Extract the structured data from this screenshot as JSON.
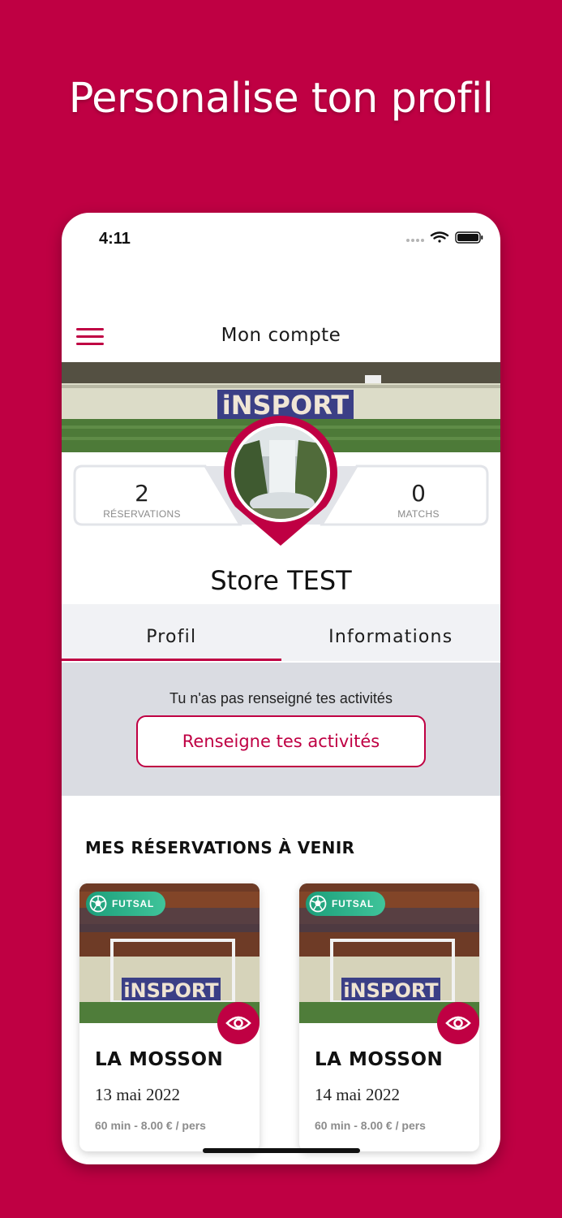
{
  "headline": "Personalise ton profil",
  "status_bar": {
    "time": "4:11"
  },
  "nav": {
    "title": "Mon compte"
  },
  "stats": {
    "reservations": {
      "value": "2",
      "label": "RÉSERVATIONS"
    },
    "matches": {
      "value": "0",
      "label": "MATCHS"
    }
  },
  "profile": {
    "name": "Store  TEST"
  },
  "tabs": [
    {
      "label": "Profil"
    },
    {
      "label": "Informations"
    }
  ],
  "activities": {
    "message": "Tu n'as pas renseigné tes activités",
    "button_label": "Renseigne tes activités"
  },
  "reservations_section": {
    "title": "MES RÉSERVATIONS À VENIR",
    "cards": [
      {
        "sport": "FUTSAL",
        "venue": "LA MOSSON",
        "date": "13 mai 2022",
        "info": "60 min - 8.00 € / pers",
        "banner_text": "iNSPORT"
      },
      {
        "sport": "FUTSAL",
        "venue": "LA MOSSON",
        "date": "14 mai 2022",
        "info": "60 min - 8.00 € / pers",
        "banner_text": "iNSPORT"
      }
    ]
  },
  "cover_banner_text": "iNSPORT",
  "colors": {
    "brand": "#bf0043",
    "badge": "#2fb28a"
  }
}
